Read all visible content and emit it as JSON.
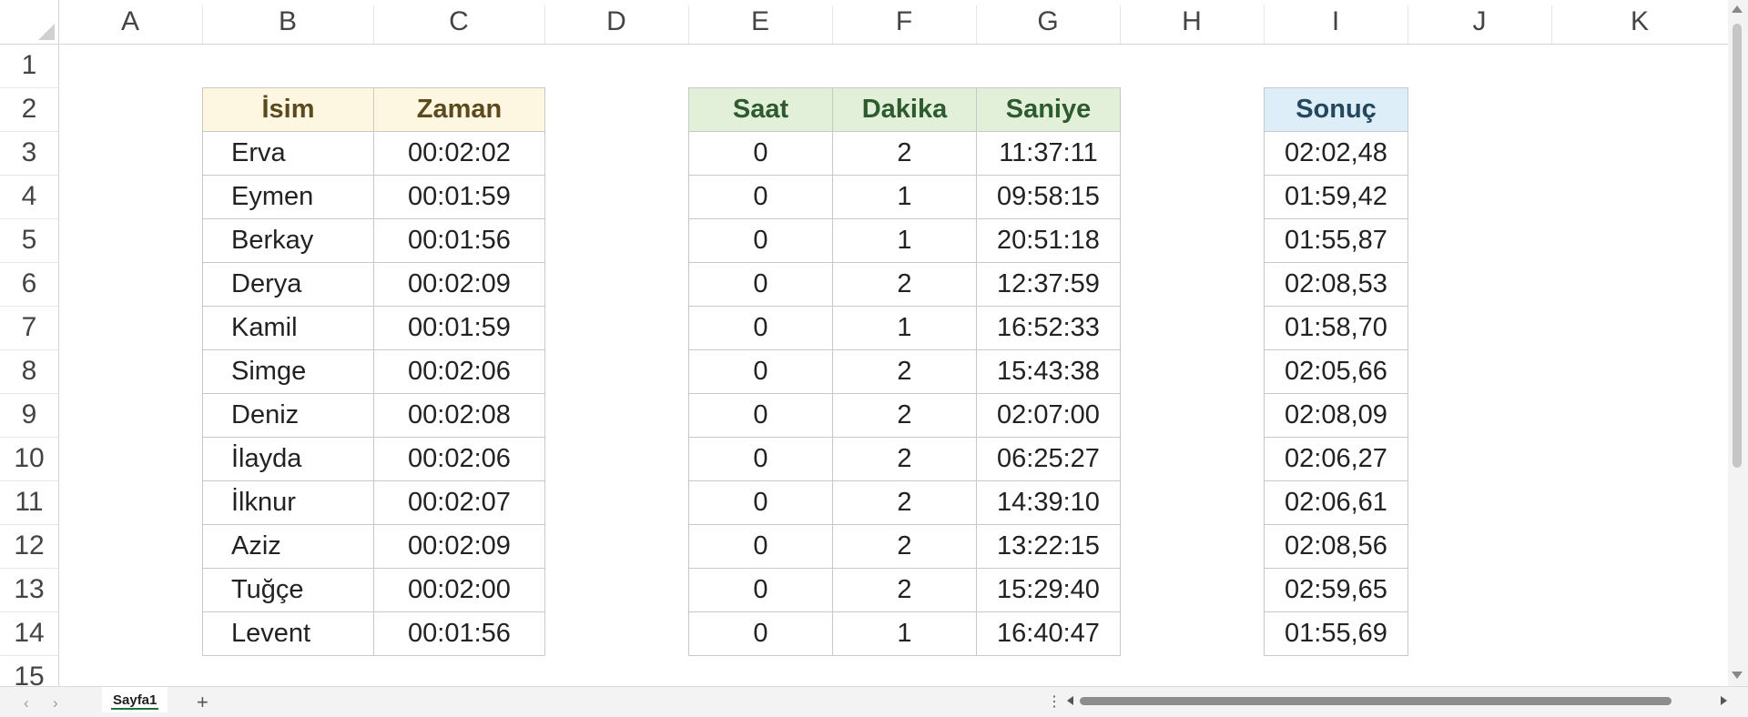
{
  "columns": [
    "A",
    "B",
    "C",
    "D",
    "E",
    "F",
    "G",
    "H",
    "I",
    "J",
    "K"
  ],
  "rows": [
    "1",
    "2",
    "3",
    "4",
    "5",
    "6",
    "7",
    "8",
    "9",
    "10",
    "11",
    "12",
    "13",
    "14",
    "15"
  ],
  "table1": {
    "headers": [
      "İsim",
      "Zaman"
    ],
    "header_bg": "#fdf7e2",
    "header_color": "#5b4a1e",
    "rows": [
      [
        "Erva",
        "00:02:02"
      ],
      [
        "Eymen",
        "00:01:59"
      ],
      [
        "Berkay",
        "00:01:56"
      ],
      [
        "Derya",
        "00:02:09"
      ],
      [
        "Kamil",
        "00:01:59"
      ],
      [
        "Simge",
        "00:02:06"
      ],
      [
        "Deniz",
        "00:02:08"
      ],
      [
        "İlayda",
        "00:02:06"
      ],
      [
        "İlknur",
        "00:02:07"
      ],
      [
        "Aziz",
        "00:02:09"
      ],
      [
        "Tuğçe",
        "00:02:00"
      ],
      [
        "Levent",
        "00:01:56"
      ]
    ]
  },
  "table2": {
    "headers": [
      "Saat",
      "Dakika",
      "Saniye"
    ],
    "header_bg": "#e2f0d9",
    "header_color": "#2e5b2e",
    "rows": [
      [
        "0",
        "2",
        "11:37:11"
      ],
      [
        "0",
        "1",
        "09:58:15"
      ],
      [
        "0",
        "1",
        "20:51:18"
      ],
      [
        "0",
        "2",
        "12:37:59"
      ],
      [
        "0",
        "1",
        "16:52:33"
      ],
      [
        "0",
        "2",
        "15:43:38"
      ],
      [
        "0",
        "2",
        "02:07:00"
      ],
      [
        "0",
        "2",
        "06:25:27"
      ],
      [
        "0",
        "2",
        "14:39:10"
      ],
      [
        "0",
        "2",
        "13:22:15"
      ],
      [
        "0",
        "2",
        "15:29:40"
      ],
      [
        "0",
        "1",
        "16:40:47"
      ]
    ]
  },
  "table3": {
    "headers": [
      "Sonuç"
    ],
    "header_bg": "#ddeef8",
    "header_color": "#23485e",
    "rows": [
      [
        "02:02,48"
      ],
      [
        "01:59,42"
      ],
      [
        "01:55,87"
      ],
      [
        "02:08,53"
      ],
      [
        "01:58,70"
      ],
      [
        "02:05,66"
      ],
      [
        "02:08,09"
      ],
      [
        "02:06,27"
      ],
      [
        "02:06,61"
      ],
      [
        "02:08,56"
      ],
      [
        "02:59,65"
      ],
      [
        "01:55,69"
      ]
    ]
  },
  "sheet_tabs": [
    "Sayfa1"
  ],
  "add_sheet_label": "+",
  "nav_prev": "‹",
  "nav_next": "›",
  "more_label": "⋮"
}
